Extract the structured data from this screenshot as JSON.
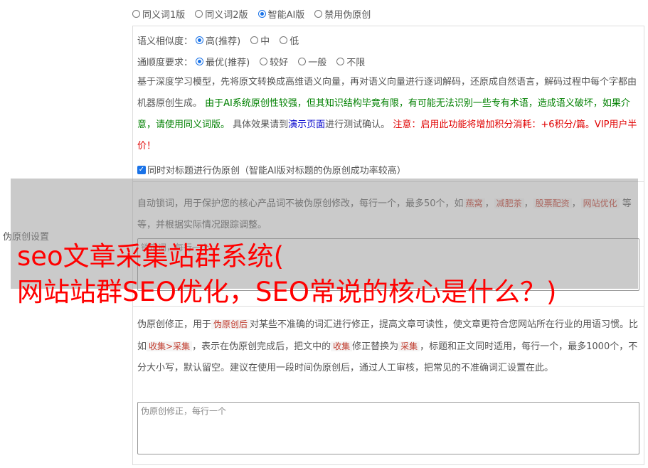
{
  "modes": [
    {
      "label": "同义词1版",
      "selected": false
    },
    {
      "label": "同义词2版",
      "selected": false
    },
    {
      "label": "智能AI版",
      "selected": true
    },
    {
      "label": "禁用伪原创",
      "selected": false
    }
  ],
  "similarity": {
    "label": "语义相似度：",
    "options": [
      {
        "label": "高(推荐)",
        "selected": true
      },
      {
        "label": "中",
        "selected": false
      },
      {
        "label": "低",
        "selected": false
      }
    ]
  },
  "fluency": {
    "label": "通顺度要求：",
    "options": [
      {
        "label": "最优(推荐)",
        "selected": true
      },
      {
        "label": "较好",
        "selected": false
      },
      {
        "label": "一般",
        "selected": false
      },
      {
        "label": "不限",
        "selected": false
      }
    ]
  },
  "description": {
    "part1": "基于深度学习模型，先将原文转换成高维语义向量，再对语义向量进行逐词解码，还原成自然语言，解码过程中每个字都由机器原创生成。 ",
    "green": "由于AI系统原创性较强，但其知识结构毕竟有限，有可能无法识别一些专有术语，造成语义破坏，如果介意，请使用同义词版。",
    "part2": " 具体效果请到",
    "link": "演示页面",
    "part3": "进行测试确认。 ",
    "red": "注意：启用此功能将增加积分消耗：+6积分/篇。VIP用户半价！"
  },
  "title_checkbox": {
    "label": "同时对标题进行伪原创（智能AI版对标题的伪原创成功率较高）",
    "checked": true
  },
  "lock_words": {
    "desc_a": "自动锁词，用于保护您的核心产品词不被伪原创修改，每行一个，最多50个，如",
    "examples": [
      "燕窝",
      "减肥茶",
      "股票配资",
      "网站优化"
    ],
    "desc_b": "等等，并根据实际情况跟踪调整。",
    "placeholder": "锁定词，每行一个"
  },
  "side_label": "伪原创设置",
  "headline": {
    "line1": "seo文章采集站群系统(",
    "line2": "网站站群SEO优化，SEO常说的核心是什么？)"
  },
  "correction": {
    "a": "伪原创修正，用于",
    "tag1": "伪原创后",
    "b": "对某些不准确的词汇进行修正，提高文章可读性，使文章更符合您网站所在行业的用语习惯。比如",
    "tag2": "收集>采集",
    "c": "，表示在伪原创完成后，把文中的",
    "tag3": "收集",
    "d": "修正替换为",
    "tag4": "采集",
    "e": "，标题和正文同时适用，每行一个，最多1000个，不分大小写，默认留空。建议在使用一段时间伪原创后，通过人工审核，把常见的不准确词汇设置在此。",
    "placeholder": "伪原创修正，每行一个"
  }
}
